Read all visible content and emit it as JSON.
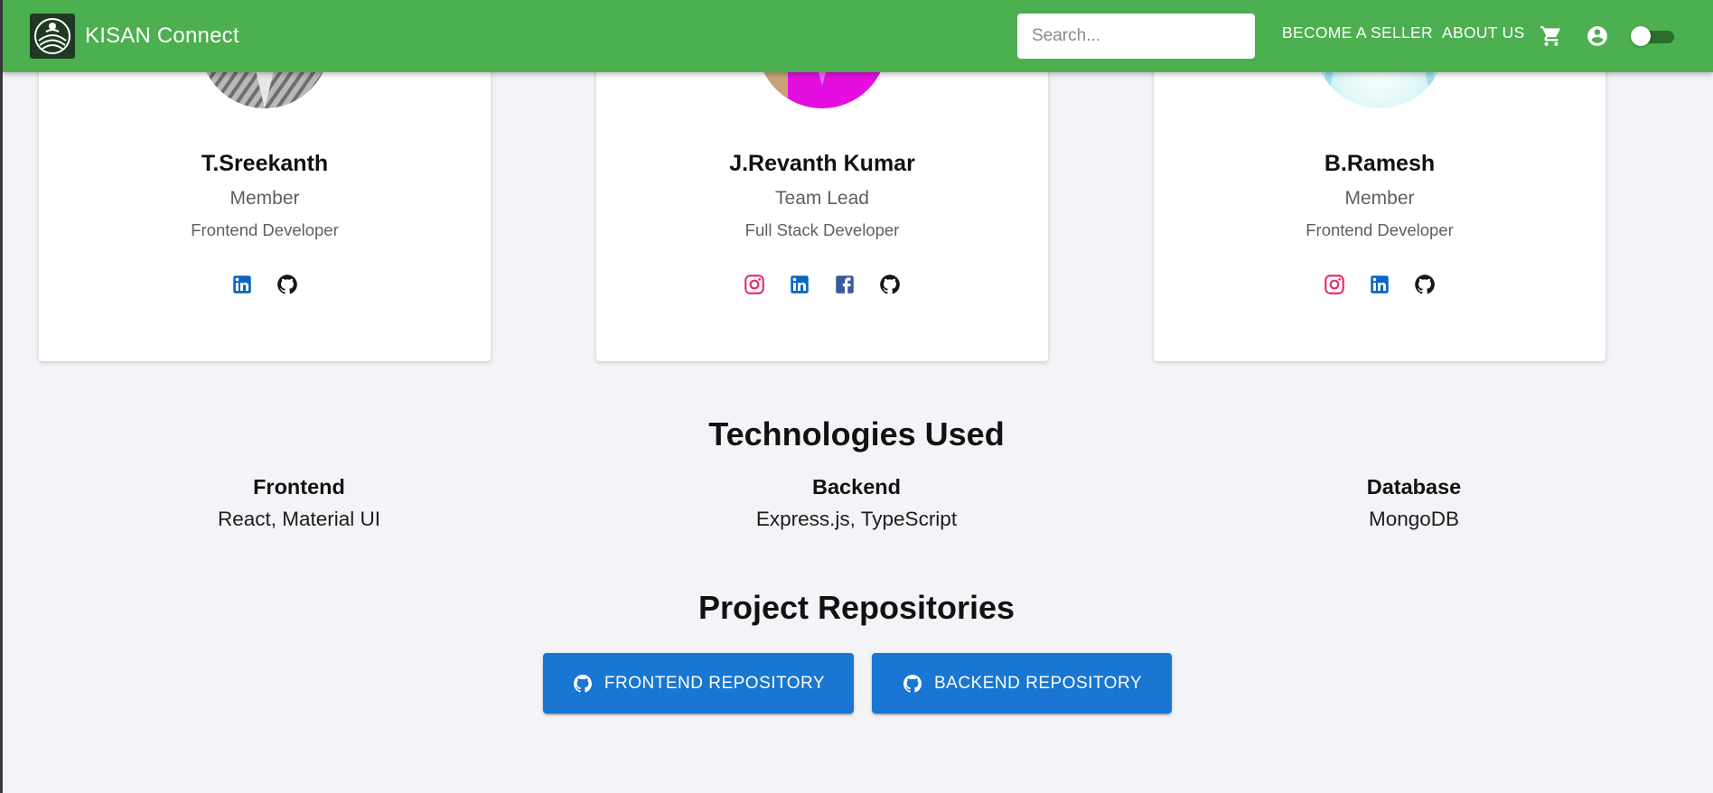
{
  "app": {
    "brand": "KISAN Connect",
    "search_placeholder": "Search...",
    "nav": {
      "become_seller": "BECOME A SELLER",
      "about_us": "ABOUT US"
    },
    "icons": [
      "cart-icon",
      "account-circle-icon"
    ],
    "theme_toggle": "off"
  },
  "colors": {
    "appbar": "#4caf50",
    "primary_button": "#1976d2",
    "page_bg": "#f3f4f7",
    "instagram": "#e1306c",
    "linkedin": "#0a66c2",
    "facebook": "#3b5998",
    "github": "#181717"
  },
  "team": [
    {
      "name": "T.Sreekanth",
      "role": "Member",
      "specialty": "Frontend Developer",
      "socials": [
        "linkedin-icon",
        "github-icon"
      ]
    },
    {
      "name": "J.Revanth Kumar",
      "role": "Team Lead",
      "specialty": "Full Stack Developer",
      "socials": [
        "instagram-icon",
        "linkedin-icon",
        "facebook-icon",
        "github-icon"
      ]
    },
    {
      "name": "B.Ramesh",
      "role": "Member",
      "specialty": "Frontend Developer",
      "socials": [
        "instagram-icon",
        "linkedin-icon",
        "github-icon"
      ]
    }
  ],
  "technologies": {
    "title": "Technologies Used",
    "items": [
      {
        "heading": "Frontend",
        "value": "React, Material UI"
      },
      {
        "heading": "Backend",
        "value": "Express.js, TypeScript"
      },
      {
        "heading": "Database",
        "value": "MongoDB"
      }
    ]
  },
  "repositories": {
    "title": "Project Repositories",
    "frontend_label": "FRONTEND REPOSITORY",
    "backend_label": "BACKEND REPOSITORY"
  }
}
